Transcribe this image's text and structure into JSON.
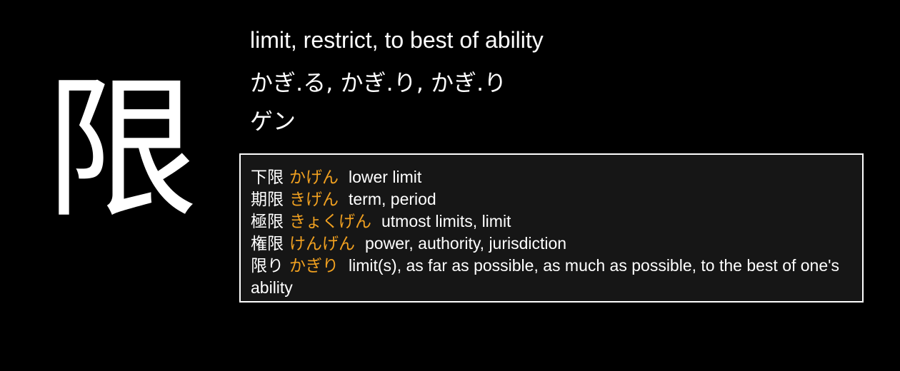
{
  "kanji": "限",
  "meaning": "limit, restrict, to best of ability",
  "kun_readings": "かぎ.る, かぎ.り, かぎ.り",
  "on_readings": "ゲン",
  "examples": [
    {
      "word": "下限",
      "reading": "かげん",
      "gloss": "lower limit"
    },
    {
      "word": "期限",
      "reading": "きげん",
      "gloss": "term, period"
    },
    {
      "word": "極限",
      "reading": "きょくげん",
      "gloss": "utmost limits, limit"
    },
    {
      "word": "権限",
      "reading": "けんげん",
      "gloss": "power, authority, jurisdiction"
    },
    {
      "word": "限り",
      "reading": "かぎり",
      "gloss": "limit(s), as far as possible, as much as possible, to the best of one's ability"
    }
  ],
  "colors": {
    "background": "#000000",
    "text": "#ffffff",
    "reading_accent": "#f0a020",
    "examples_panel": "#161616",
    "examples_border": "#ffffff"
  }
}
